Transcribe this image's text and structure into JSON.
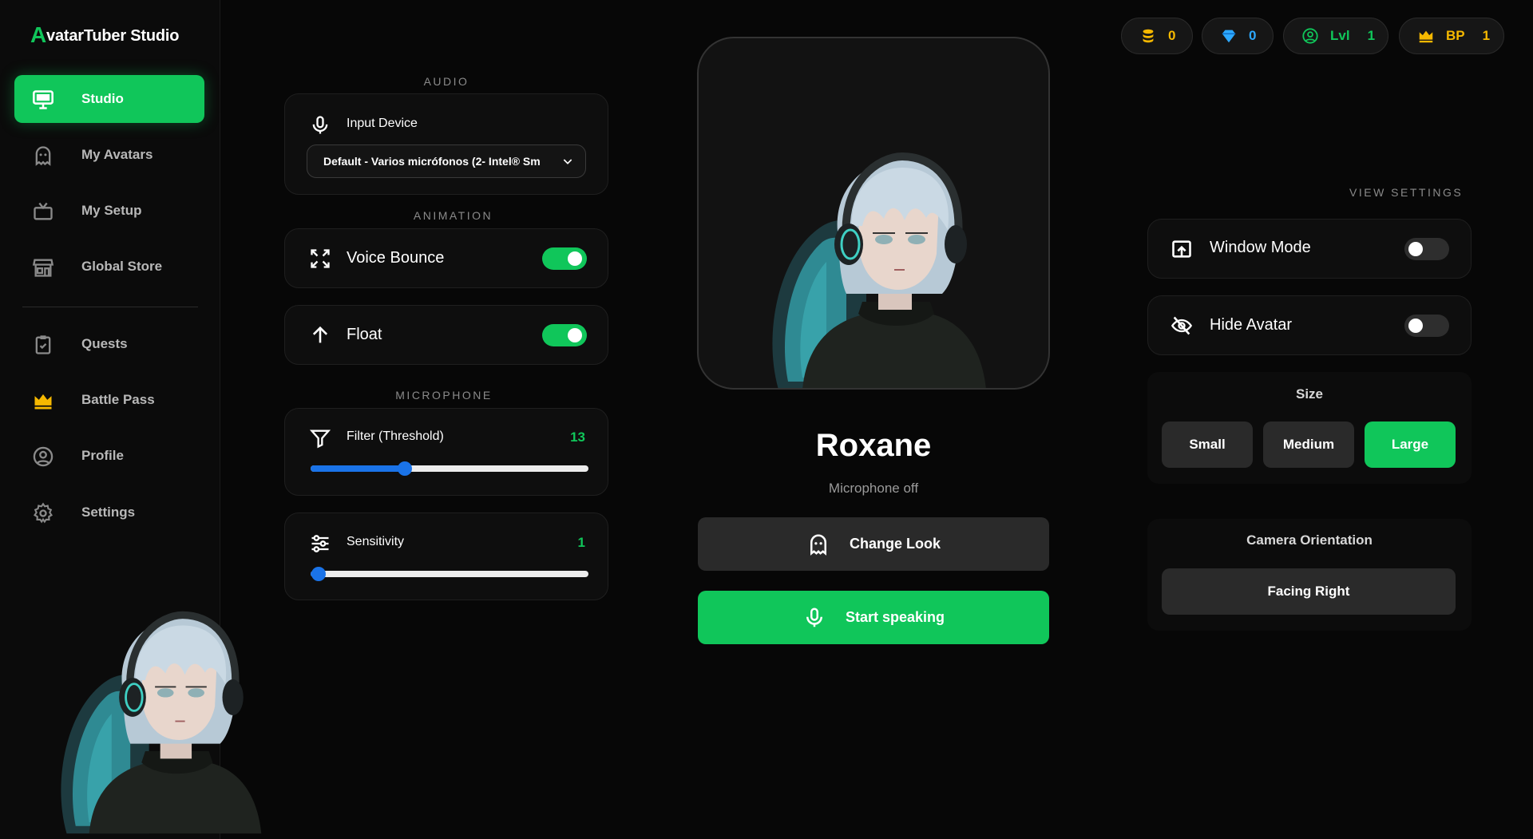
{
  "app": {
    "logo_letter": "A",
    "logo_rest": "vatarTuber Studio"
  },
  "sidebar": {
    "items": [
      {
        "label": "Studio",
        "icon": "monitor-icon"
      },
      {
        "label": "My Avatars",
        "icon": "ghost-icon"
      },
      {
        "label": "My Setup",
        "icon": "tv-icon"
      },
      {
        "label": "Global Store",
        "icon": "store-icon"
      },
      {
        "label": "Quests",
        "icon": "clipboard-check-icon"
      },
      {
        "label": "Battle Pass",
        "icon": "crown-icon"
      },
      {
        "label": "Profile",
        "icon": "user-circle-icon"
      },
      {
        "label": "Settings",
        "icon": "gear-icon"
      }
    ]
  },
  "stats": {
    "coins": "0",
    "gems": "0",
    "lvl_label": "Lvl",
    "lvl_value": "1",
    "bp_label": "BP",
    "bp_value": "1"
  },
  "audio": {
    "section": "AUDIO",
    "input_label": "Input Device",
    "input_value": "Default - Varios micrófonos (2- Intel® Sm"
  },
  "animation": {
    "section": "ANIMATION",
    "voice_bounce_label": "Voice Bounce",
    "voice_bounce_on": true,
    "float_label": "Float",
    "float_on": true
  },
  "microphone": {
    "section": "MICROPHONE",
    "filter_label": "Filter (Threshold)",
    "filter_value": "13",
    "filter_fraction": 0.34,
    "sensitivity_label": "Sensitivity",
    "sensitivity_value": "1",
    "sensitivity_fraction": 0.03
  },
  "avatar": {
    "name": "Roxane",
    "status": "Microphone off",
    "change_look": "Change Look",
    "start_speaking": "Start speaking"
  },
  "view_settings": {
    "section": "VIEW SETTINGS",
    "window_mode": "Window Mode",
    "window_mode_on": false,
    "hide_avatar": "Hide Avatar",
    "hide_avatar_on": false,
    "size_title": "Size",
    "sizes": [
      "Small",
      "Medium",
      "Large"
    ],
    "selected_size": "Large",
    "camera_title": "Camera Orientation",
    "camera_value": "Facing Right"
  },
  "colors": {
    "accent": "#10c65a",
    "slider_blue": "#1a73e8",
    "coin_yellow": "#f5b800",
    "gem_blue": "#2da8ff",
    "background": "#070707"
  }
}
